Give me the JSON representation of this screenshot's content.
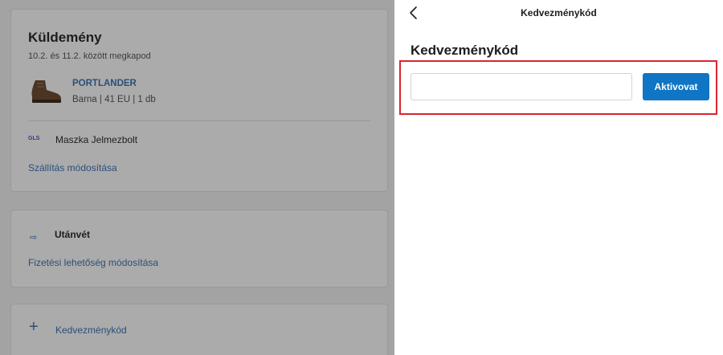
{
  "background": {
    "shipment": {
      "title": "Küldemény",
      "delivery": "10.2. és 11.2. között megkapod",
      "product_name": "PORTLANDER",
      "product_meta": "Barna | 41 EU | 1 db",
      "carrier_icon": "GLS",
      "carrier": "Maszka Jelmezbolt",
      "change_shipping": "Szállítás módosítása"
    },
    "payment": {
      "icon": "cash-on-delivery-icon",
      "title": "Utánvét",
      "change_payment": "Fizetési lehetőség módosítása"
    },
    "coupon": {
      "icon": "plus-icon",
      "label": "Kedvezménykód"
    }
  },
  "panel": {
    "header_title": "Kedvezménykód",
    "back_icon": "chevron-left-icon",
    "title": "Kedvezménykód",
    "input": {
      "value": "",
      "placeholder": ""
    },
    "activate_label": "Aktivovat",
    "highlight_color": "#d7262d",
    "accent_color": "#0f75c4"
  }
}
